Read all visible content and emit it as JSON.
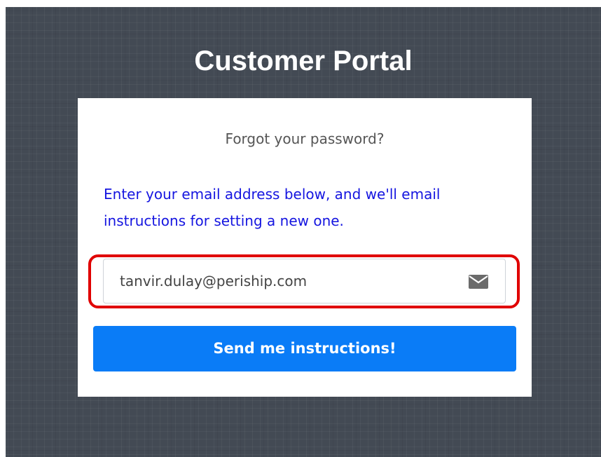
{
  "page": {
    "title": "Customer Portal"
  },
  "form": {
    "subtitle": "Forgot your password?",
    "instructions_line1": "Enter your email address below, and we'll email",
    "instructions_line2": "instructions for setting a new one.",
    "email_value": "tanvir.dulay@periship.com",
    "email_icon": "envelope-icon",
    "submit_label": "Send me instructions!"
  },
  "colors": {
    "background": "#434a54",
    "card": "#ffffff",
    "instructions_text": "#1515e0",
    "button": "#0a7cf7",
    "highlight_outline": "#e00000"
  }
}
